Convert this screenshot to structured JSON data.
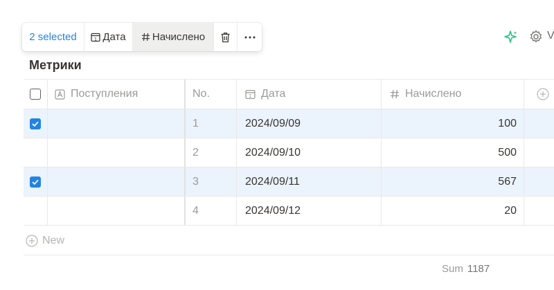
{
  "toolbar": {
    "selected_label": "2 selected",
    "date_label": "Дата",
    "nach_label": "Начислено"
  },
  "header_right": {
    "view_label": "V"
  },
  "table": {
    "title": "Метрики",
    "columns": {
      "post": "Поступления",
      "no": "No.",
      "date": "Дата",
      "nach": "Начислено"
    },
    "rows": [
      {
        "no": "1",
        "date": "2024/09/09",
        "nach": "100",
        "selected": true
      },
      {
        "no": "2",
        "date": "2024/09/10",
        "nach": "500",
        "selected": false
      },
      {
        "no": "3",
        "date": "2024/09/11",
        "nach": "567",
        "selected": true
      },
      {
        "no": "4",
        "date": "2024/09/12",
        "nach": "20",
        "selected": false
      }
    ],
    "new_label": "New",
    "sum_label": "Sum",
    "sum_value": "1187"
  },
  "colors": {
    "accent": "#2383e2",
    "selected_row": "#ebf3fc",
    "ai": "#21c485"
  }
}
